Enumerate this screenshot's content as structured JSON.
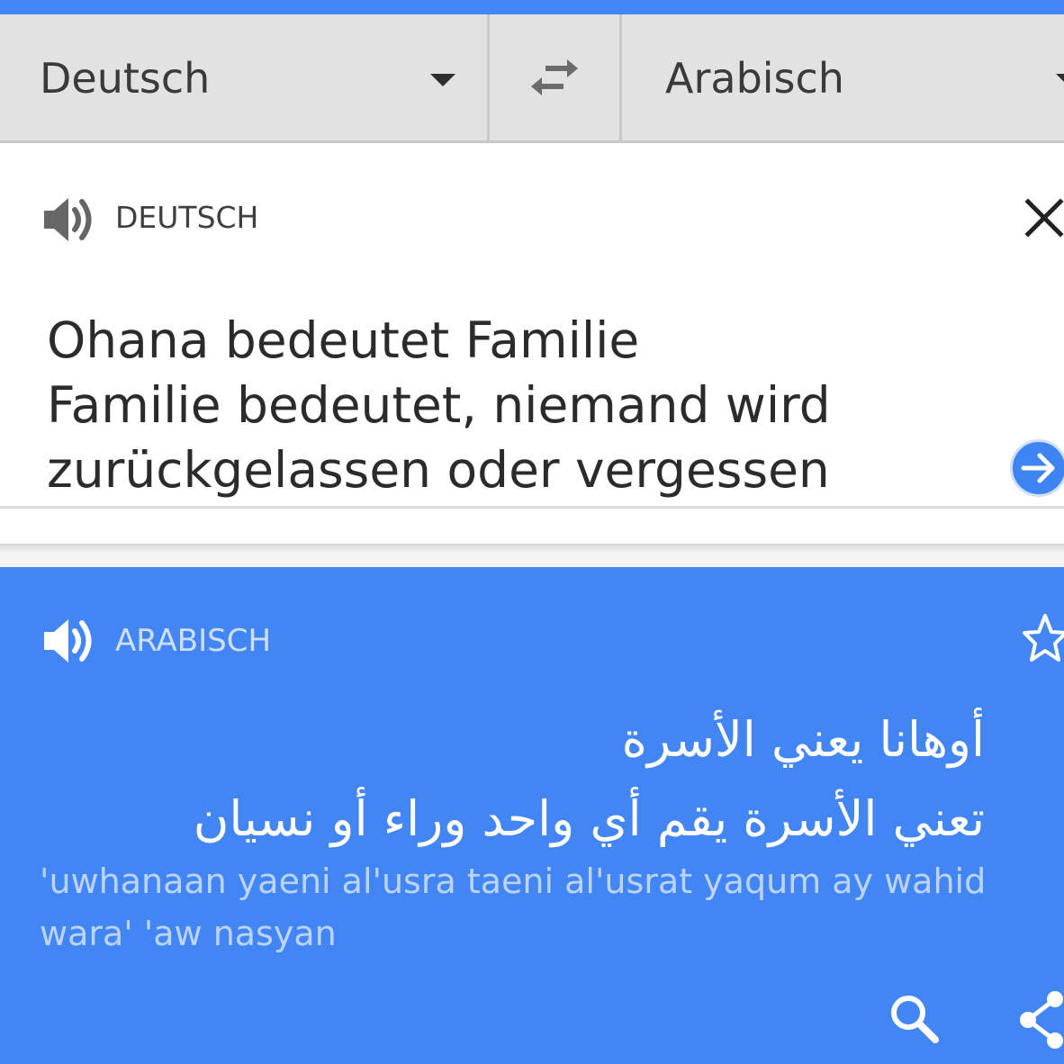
{
  "colors": {
    "accent": "#4286f5",
    "language_bar": "#e2e2e2",
    "translit_text": "#bcd4fb"
  },
  "language_bar": {
    "source_language": "Deutsch",
    "target_language": "Arabisch",
    "swap_icon": "swap-arrows-icon",
    "dropdown_icon": "caret-down-icon"
  },
  "input": {
    "language_label": "DEUTSCH",
    "speaker_icon": "speaker-icon",
    "clear_icon": "close-icon",
    "text": "Ohana bedeutet Familie\nFamilie bedeutet, niemand wird\nzurückgelassen oder vergessen",
    "submit_icon": "arrow-right-icon"
  },
  "result": {
    "language_label": "ARABISCH",
    "speaker_icon": "speaker-icon",
    "favorite_icon": "star-icon",
    "translation": "أوهانا يعني الأسرة\nتعني الأسرة يقم أي واحد وراء أو نسيان",
    "transliteration": "'uwhanaan yaeni al'usra taeni al'usrat yaqum ay wahid wara' 'aw nasyan",
    "search_icon": "search-icon",
    "share_icon": "share-icon"
  }
}
